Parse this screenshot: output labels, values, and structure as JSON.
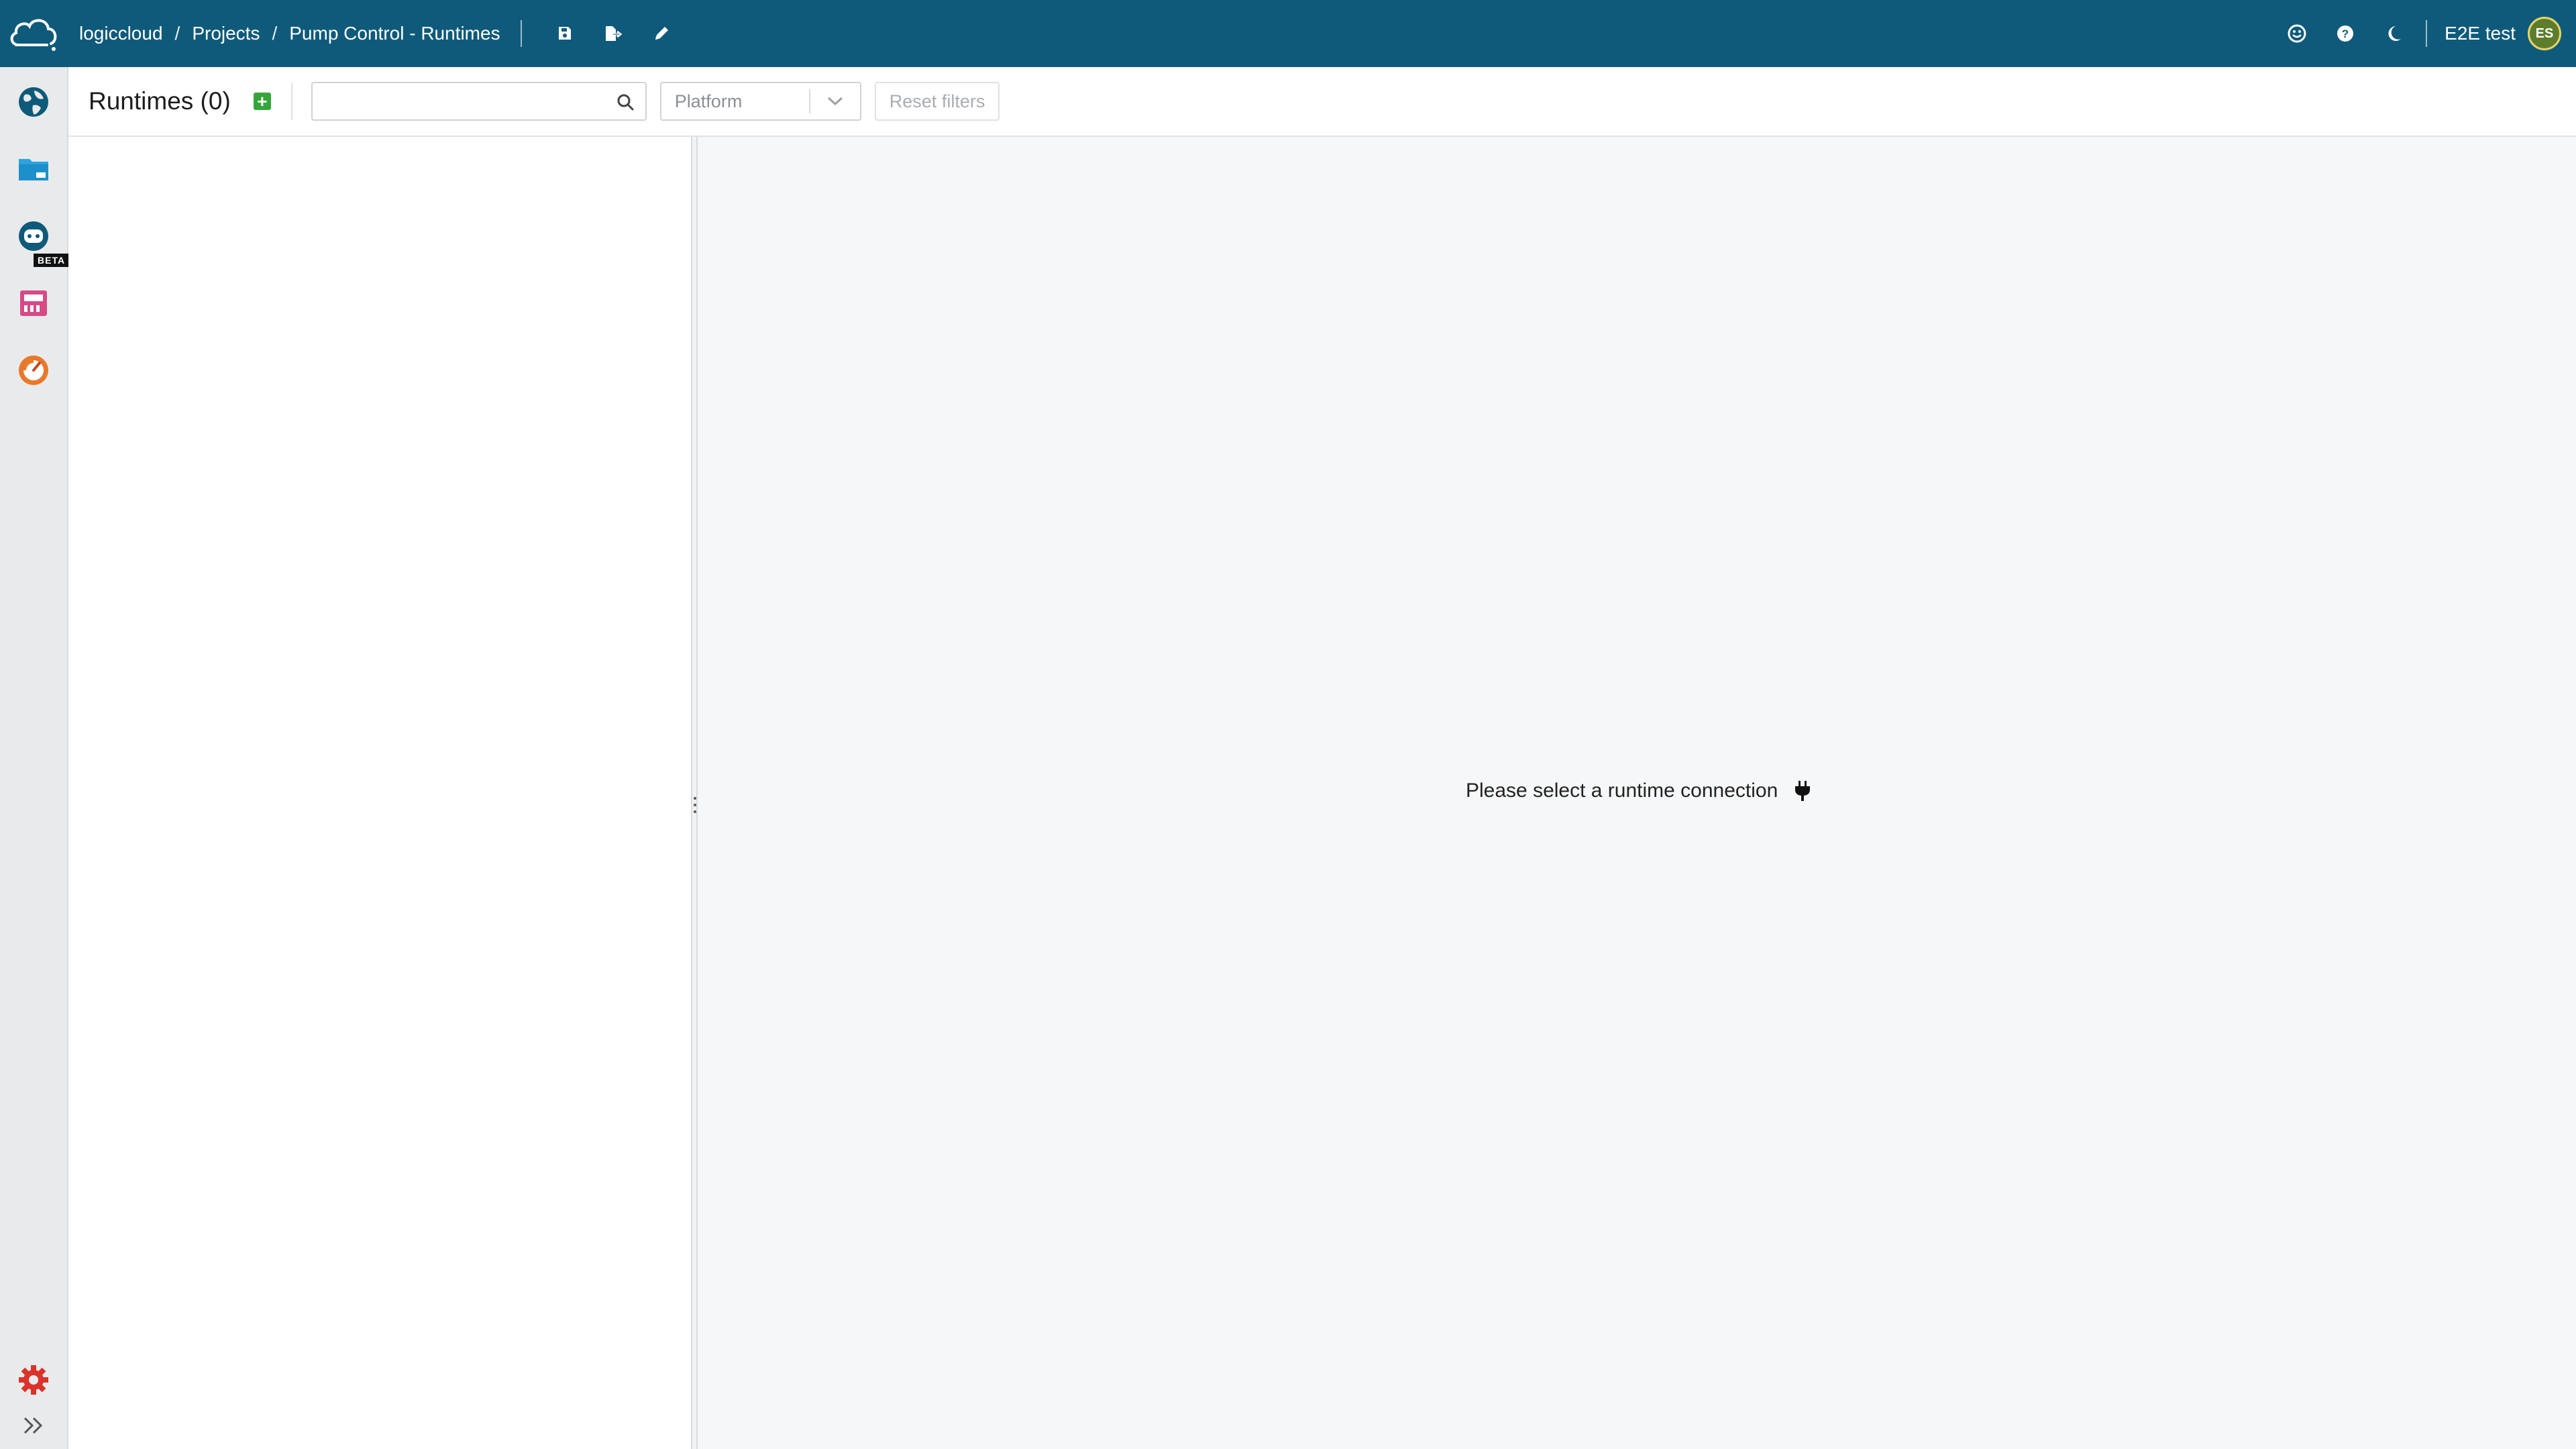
{
  "header": {
    "breadcrumb": [
      {
        "label": "logiccloud"
      },
      {
        "label": "Projects"
      },
      {
        "label": "Pump Control - Runtimes"
      }
    ],
    "separator": "/",
    "user_name": "E2E test",
    "avatar_initials": "ES"
  },
  "rail": {
    "beta_label": "BETA"
  },
  "toolbar": {
    "title": "Runtimes (0)",
    "add_label": "+",
    "search_value": "",
    "platform_select_value": "Platform",
    "reset_filters_label": "Reset filters"
  },
  "detail": {
    "empty_message": "Please select a runtime connection"
  },
  "colors": {
    "header_bg": "#0f5a7a",
    "add_green": "#37a63a",
    "files_blue": "#2aa3df",
    "settings_red": "#d9342b",
    "product_pink": "#d64a86",
    "product_orange": "#e8782a"
  },
  "icons": {
    "logo": "cloud-logo-icon",
    "save": "save-icon",
    "export": "export-file-icon",
    "edit": "pencil-icon",
    "feedback": "smiley-icon",
    "help": "help-icon",
    "theme": "moon-icon",
    "globe": "globe-icon",
    "files": "folder-icon",
    "assistant": "robot-icon",
    "plc": "plc-device-icon",
    "monitor": "gauge-icon",
    "settings": "gear-icon",
    "expand": "double-chevron-right-icon",
    "search": "search-icon",
    "plug": "plug-icon"
  }
}
